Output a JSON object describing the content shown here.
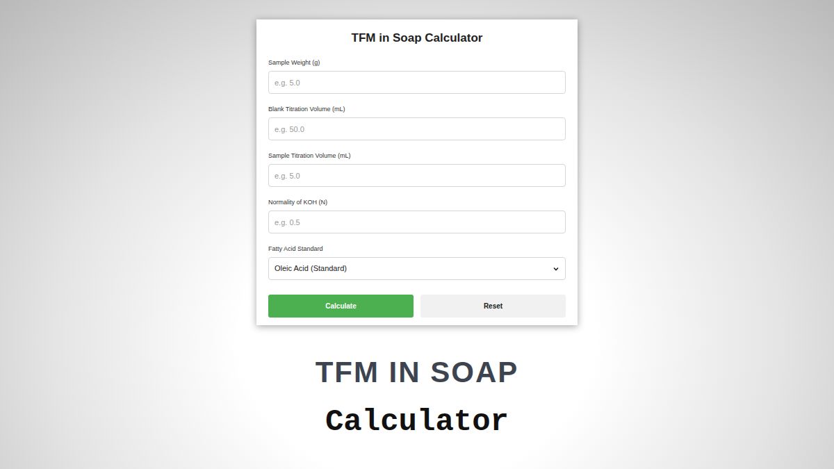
{
  "card": {
    "title": "TFM in Soap Calculator",
    "fields": [
      {
        "label": "Sample Weight (g)",
        "placeholder": "e.g. 5.0"
      },
      {
        "label": "Blank Titration Volume (mL)",
        "placeholder": "e.g. 50.0"
      },
      {
        "label": "Sample Titration Volume (mL)",
        "placeholder": "e.g. 5.0"
      },
      {
        "label": "Normality of KOH (N)",
        "placeholder": "e.g. 0.5"
      }
    ],
    "select": {
      "label": "Fatty Acid Standard",
      "value": "Oleic Acid (Standard)"
    },
    "buttons": [
      {
        "label": "Calculate",
        "kind": "primary"
      },
      {
        "label": "Reset",
        "kind": "secondary"
      }
    ]
  },
  "heading": {
    "title": "TFM IN SOAP",
    "subtitle": "Calculator"
  }
}
